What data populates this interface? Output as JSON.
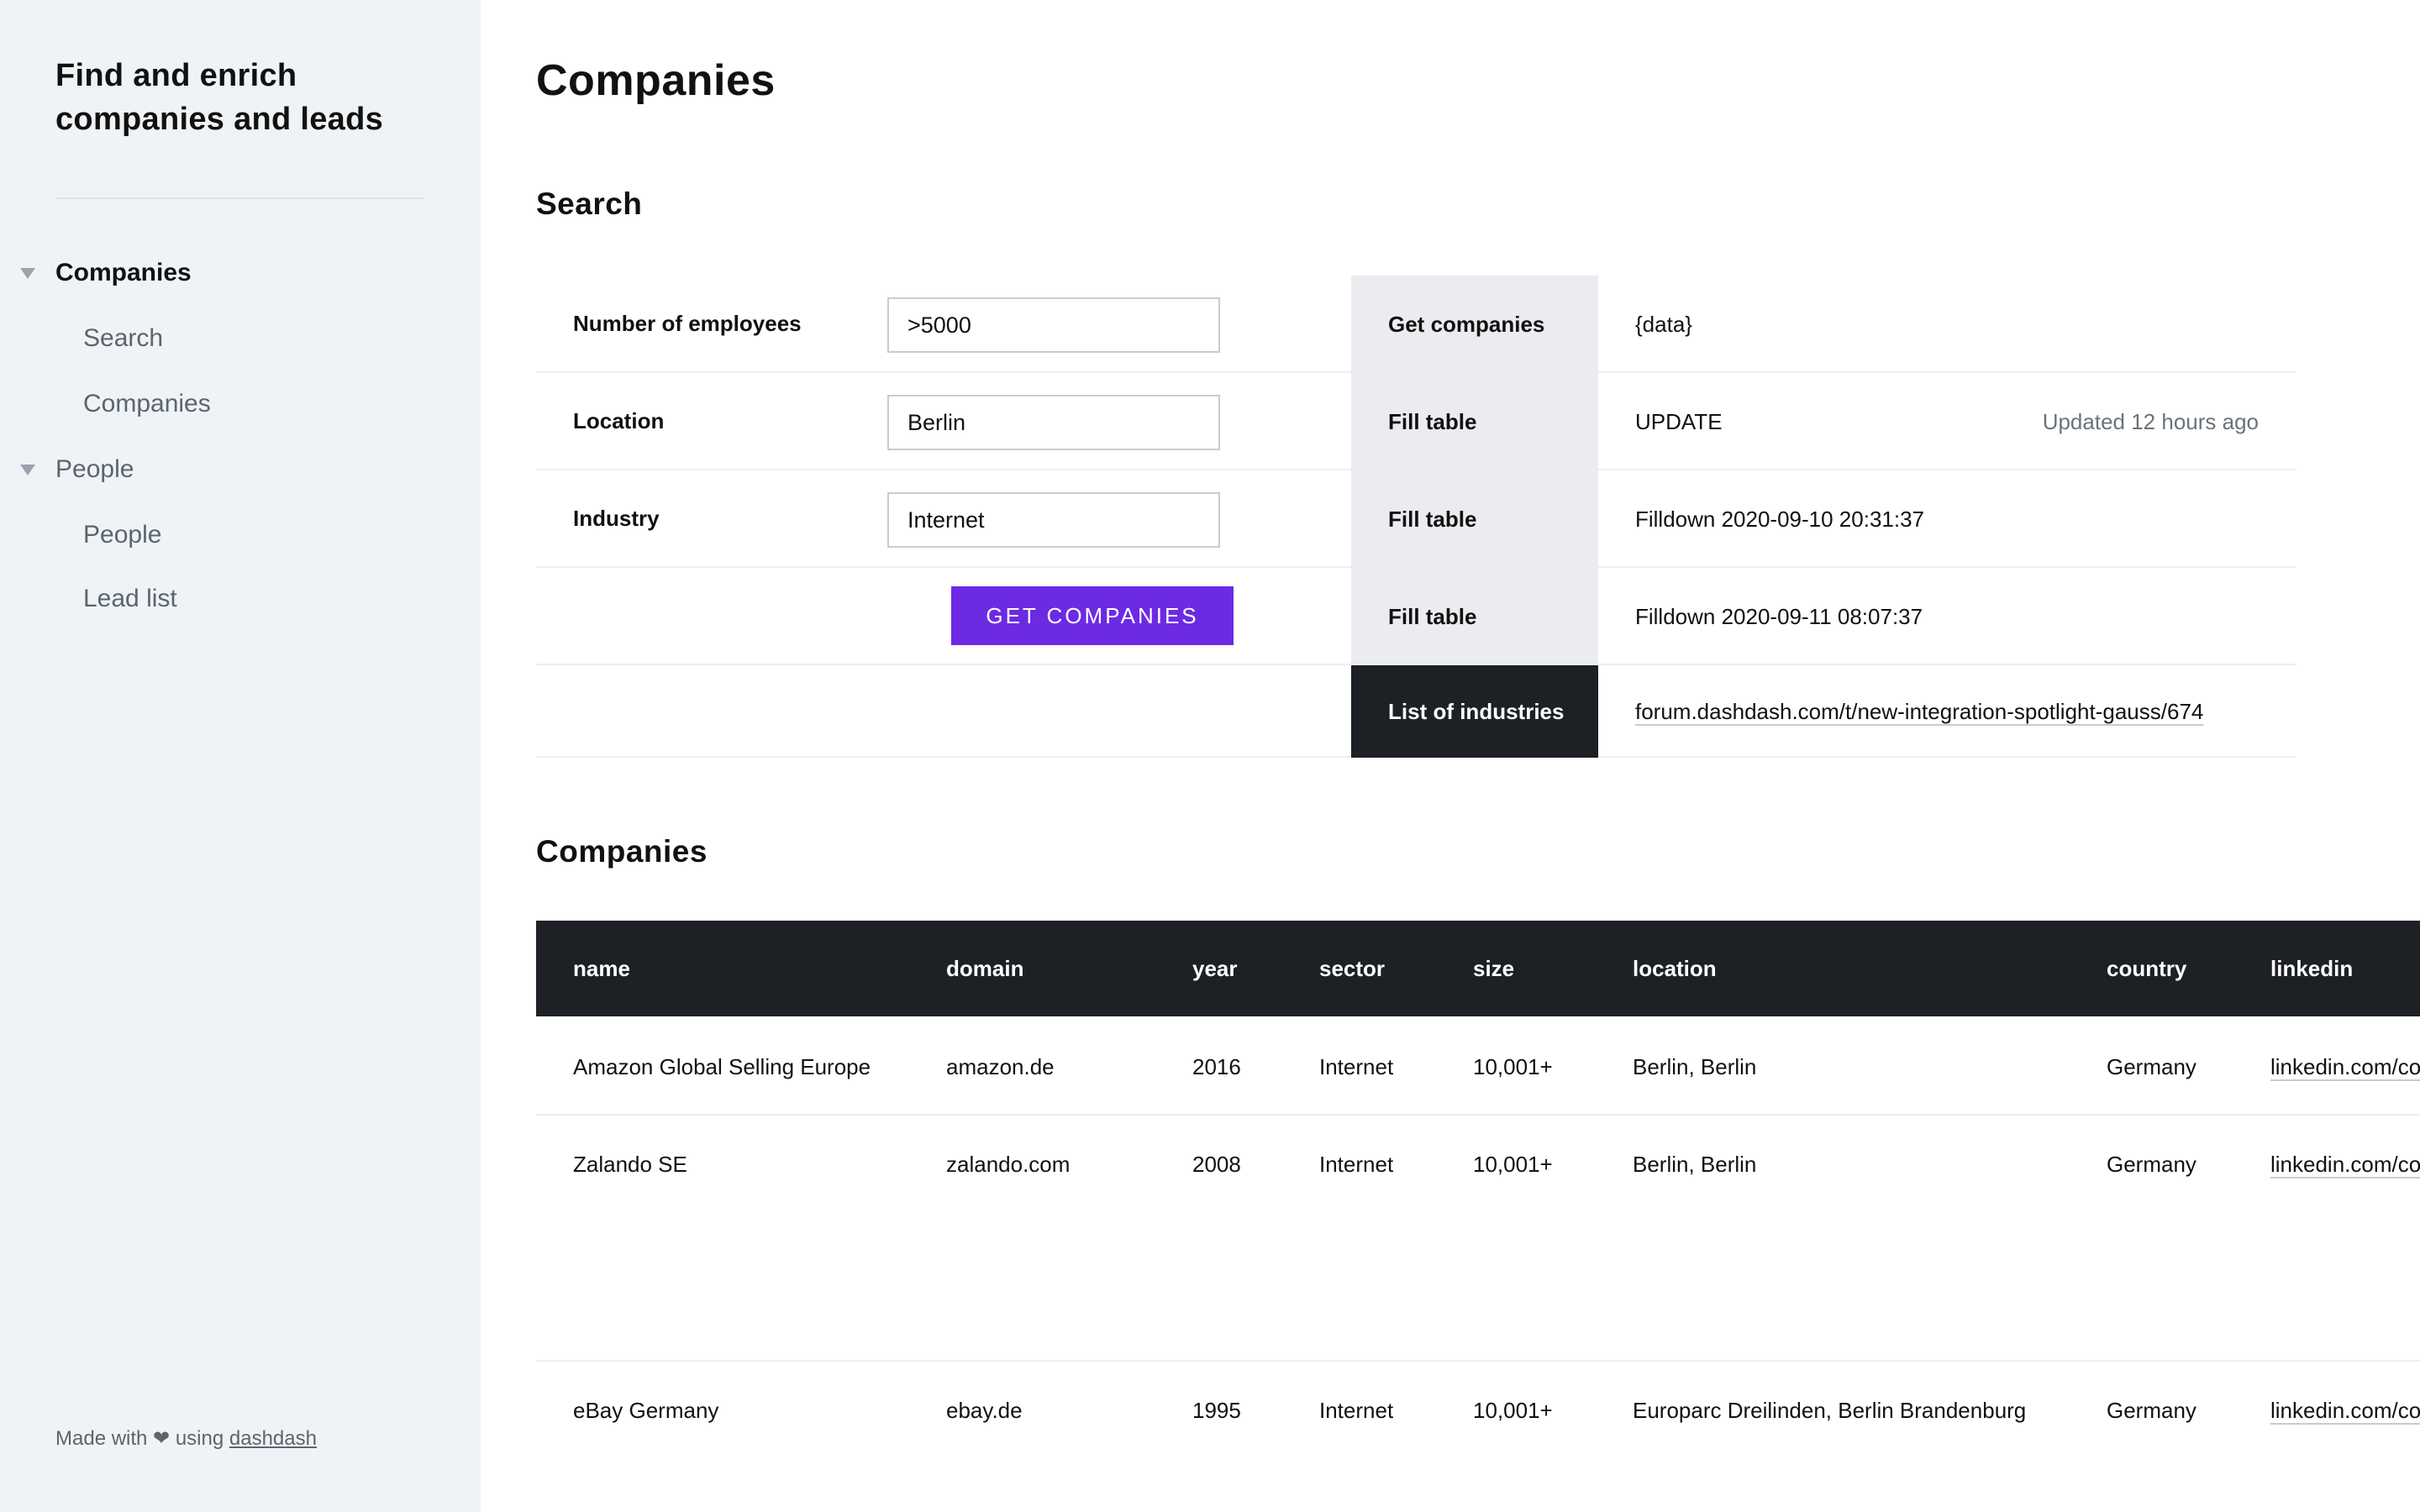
{
  "sidebar": {
    "app_title": "Find and enrich companies and leads",
    "sections": [
      {
        "label": "Companies",
        "items": [
          "Search",
          "Companies"
        ]
      },
      {
        "label": "People",
        "items": [
          "People",
          "Lead list"
        ]
      }
    ],
    "footer": {
      "prefix": "Made with ❤ using ",
      "link": "dashdash"
    }
  },
  "page": {
    "title": "Companies",
    "search_heading": "Search",
    "companies_heading": "Companies"
  },
  "search": {
    "fields": [
      {
        "label": "Number of employees",
        "value": ">5000"
      },
      {
        "label": "Location",
        "value": "Berlin"
      },
      {
        "label": "Industry",
        "value": "Internet"
      }
    ],
    "button_label": "GET COMPANIES"
  },
  "actions": [
    {
      "label": "Get companies",
      "value": "{data}",
      "meta": ""
    },
    {
      "label": "Fill table",
      "value": "UPDATE",
      "meta": "Updated 12 hours ago"
    },
    {
      "label": "Fill table",
      "value": "Filldown 2020-09-10 20:31:37",
      "meta": ""
    },
    {
      "label": "Fill table",
      "value": "Filldown 2020-09-11 08:07:37",
      "meta": ""
    },
    {
      "label": "List of industries",
      "value": "forum.dashdash.com/t/new-integration-spotlight-gauss/674",
      "meta": ""
    }
  ],
  "table": {
    "columns": [
      "name",
      "domain",
      "year",
      "sector",
      "size",
      "location",
      "country",
      "linkedin"
    ],
    "rows": [
      [
        "Amazon Global Selling Europe",
        "amazon.de",
        "2016",
        "Internet",
        "10,001+",
        "Berlin, Berlin",
        "Germany",
        "linkedin.com/co"
      ],
      [
        "Zalando SE",
        "zalando.com",
        "2008",
        "Internet",
        "10,001+",
        "Berlin, Berlin",
        "Germany",
        "linkedin.com/co"
      ],
      [
        "eBay Germany",
        "ebay.de",
        "1995",
        "Internet",
        "10,001+",
        "Europarc Dreilinden, Berlin Brandenburg",
        "Germany",
        "linkedin.com/co"
      ]
    ]
  }
}
